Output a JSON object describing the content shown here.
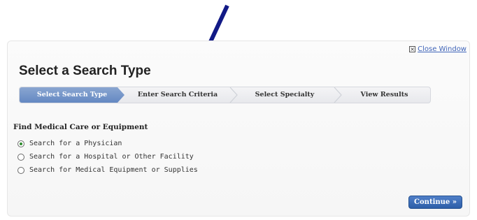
{
  "dialog": {
    "close_label": "Close Window",
    "title": "Select a Search Type"
  },
  "steps": [
    {
      "label": "Select Search Type",
      "active": true
    },
    {
      "label": "Enter Search Criteria",
      "active": false
    },
    {
      "label": "Select Specialty",
      "active": false
    },
    {
      "label": "View Results",
      "active": false
    }
  ],
  "section": {
    "title": "Find Medical Care or Equipment"
  },
  "options": [
    {
      "label": "Search for a Physician",
      "checked": true
    },
    {
      "label": "Search for a Hospital or Other Facility",
      "checked": false
    },
    {
      "label": "Search for Medical Equipment or Supplies",
      "checked": false
    }
  ],
  "continue_label": "Continue »",
  "colors": {
    "accent": "#2d5ea8",
    "active_step": "#6488c2",
    "arrow": "#121a86"
  }
}
